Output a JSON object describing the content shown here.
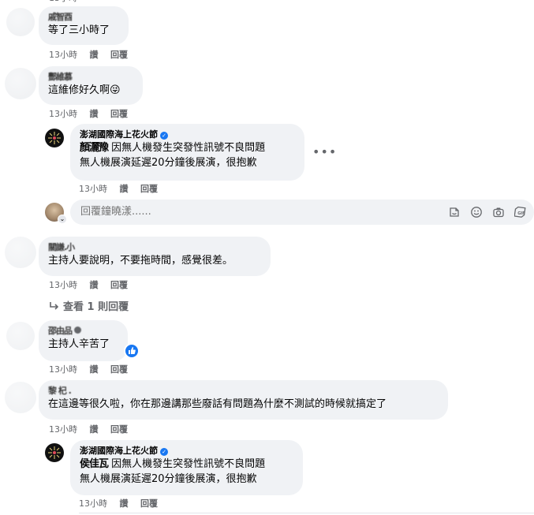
{
  "comments": [
    {
      "author": "戚智酉",
      "text": "等了三小時了",
      "time": "13小時",
      "like": "讚",
      "reply": "回覆"
    },
    {
      "author": "酆維慕",
      "text": "這維修好久啊😜",
      "time": "13小時",
      "like": "讚",
      "reply": "回覆"
    },
    {
      "author": "澎湖國際海上花火節",
      "mention": "顏灑豫",
      "text_line1": "因無人機發生突發性訊號不良問題",
      "text_line2": "無人機展演延遲20分鐘後展演，很抱歉",
      "time": "13小時",
      "like": "讚",
      "reply": "回覆",
      "more": "•••"
    },
    {
      "author": "關謙.小",
      "text": "主持人要說明，不要拖時間，感覺很差。",
      "time": "13小時",
      "like": "讚",
      "reply": "回覆"
    },
    {
      "author": "邵由品",
      "text": "主持人辛苦了",
      "time": "13小時",
      "like": "讚",
      "reply": "回覆"
    },
    {
      "author": "黎 杞 .",
      "text": "在這邊等很久啦，你在那邊講那些廢話有問題為什麼不測試的時候就搞定了",
      "time": "13小時",
      "like": "讚",
      "reply": "回覆"
    },
    {
      "author": "澎湖國際海上花火節",
      "mention": "侯佳瓦",
      "text_line1": "因無人機發生突發性訊號不良問題",
      "text_line2": "無人機展演延遲20分鐘後展演，很抱歉",
      "time": "13小時",
      "like": "讚",
      "reply": "回覆"
    }
  ],
  "reply_box": {
    "placeholder": "回覆鐘曉漾......"
  },
  "view_replies": {
    "label": "查看 1 則回覆"
  },
  "colors": {
    "bubble": "#f0f2f5",
    "meta": "#65676b",
    "accent": "#1877f2"
  },
  "icons": [
    "sticker-icon",
    "emoji-icon",
    "camera-icon",
    "gif-icon",
    "verified-icon",
    "like-icon",
    "reply-arrow-icon",
    "more-icon"
  ]
}
